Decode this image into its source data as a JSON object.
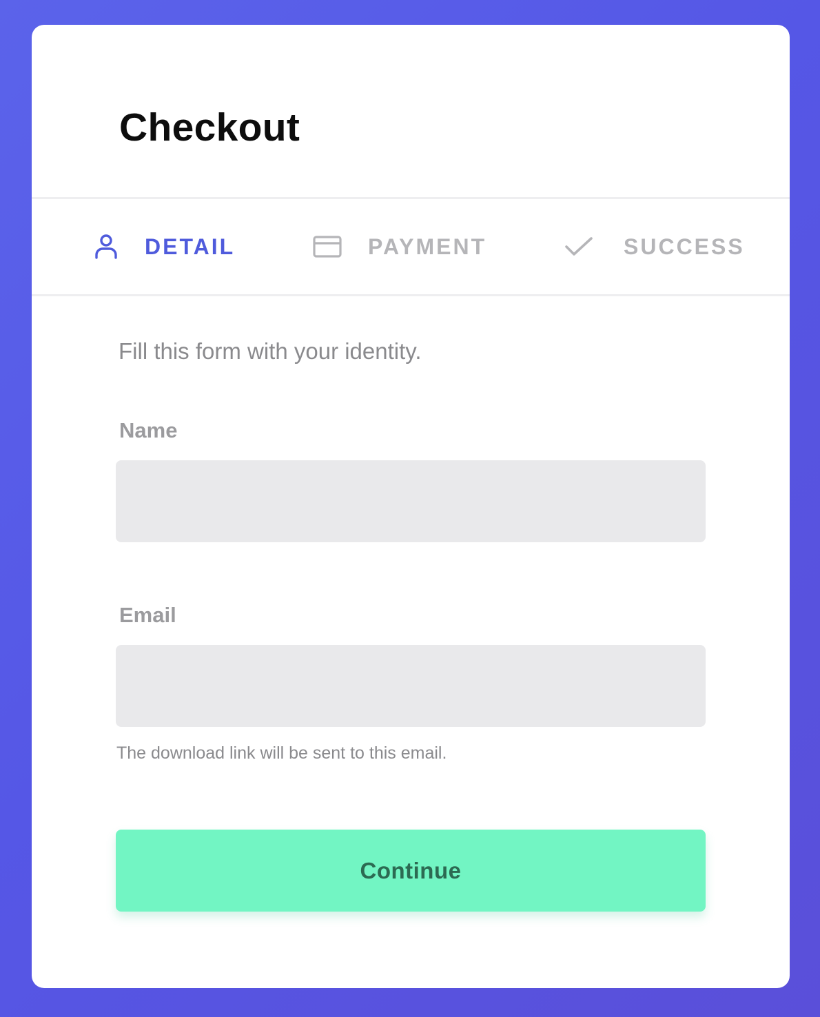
{
  "header": {
    "title": "Checkout"
  },
  "steps": [
    {
      "label": "DETAIL",
      "icon": "user-icon",
      "state": "active",
      "color": "#4f5bdc"
    },
    {
      "label": "PAYMENT",
      "icon": "credit-card-icon",
      "state": "inactive",
      "color": "#b5b5b8"
    },
    {
      "label": "SUCCESS",
      "icon": "check-icon",
      "state": "inactive",
      "color": "#b5b5b8"
    }
  ],
  "form": {
    "intro": "Fill this form with your identity.",
    "name": {
      "label": "Name",
      "value": "",
      "placeholder": ""
    },
    "email": {
      "label": "Email",
      "value": "",
      "placeholder": "",
      "hint": "The download link will be sent to this email."
    },
    "submit_label": "Continue"
  },
  "colors": {
    "background": "#5557e6",
    "accent": "#4f5bdc",
    "button": "#72f5c3",
    "button_text": "#2c6a52",
    "input_bg": "#e9e9eb"
  }
}
